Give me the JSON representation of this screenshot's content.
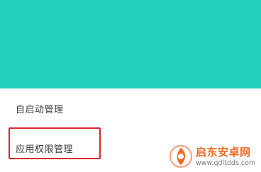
{
  "menu": {
    "items": [
      {
        "label": "自启动管理"
      },
      {
        "label": "应用权限管理"
      }
    ]
  },
  "watermark": {
    "title": "启东安卓网",
    "url": "www.qdltdds.com"
  },
  "colors": {
    "header": "#22d2bd",
    "highlight": "#d8282c",
    "watermark_text": "#ef6a2a"
  }
}
